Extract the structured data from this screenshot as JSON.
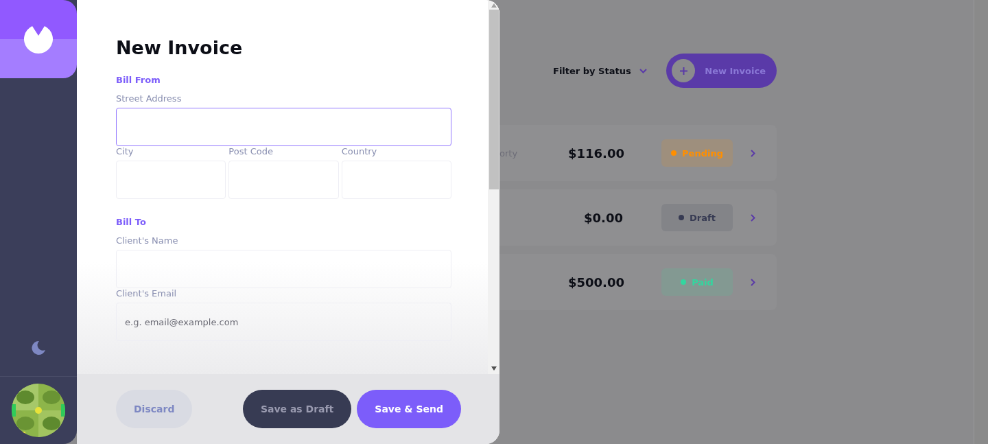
{
  "form": {
    "title": "New Invoice",
    "sections": [
      {
        "heading": "Bill From",
        "rows": [
          [
            {
              "label": "Street Address",
              "focused": true
            }
          ],
          [
            {
              "label": "City",
              "focused": false
            },
            {
              "label": "Post Code",
              "focused": false
            },
            {
              "label": "Country",
              "focused": false
            }
          ]
        ]
      },
      {
        "heading": "Bill To",
        "rows": [
          [
            {
              "label": "Client's Name",
              "focused": false
            }
          ],
          [
            {
              "label": "Client's Email",
              "placeholder": "e.g. email@example.com",
              "focused": false
            }
          ]
        ]
      }
    ],
    "buttons": [
      {
        "label": "Discard",
        "kind": "light"
      },
      {
        "label": "Save as Draft",
        "kind": "dark"
      },
      {
        "label": "Save & Send",
        "kind": "primary"
      }
    ]
  },
  "toolbar": {
    "filter": "Filter by Status",
    "new_button": "New Invoice"
  },
  "invoices": [
    {
      "client": "orty",
      "amount": "$116.00",
      "status": "Pending",
      "color": "#ff8f00"
    },
    {
      "amount": "$0.00",
      "status": "Draft",
      "color": "#373b53"
    },
    {
      "amount": "$500.00",
      "status": "Paid",
      "color": "#33d69f"
    }
  ]
}
